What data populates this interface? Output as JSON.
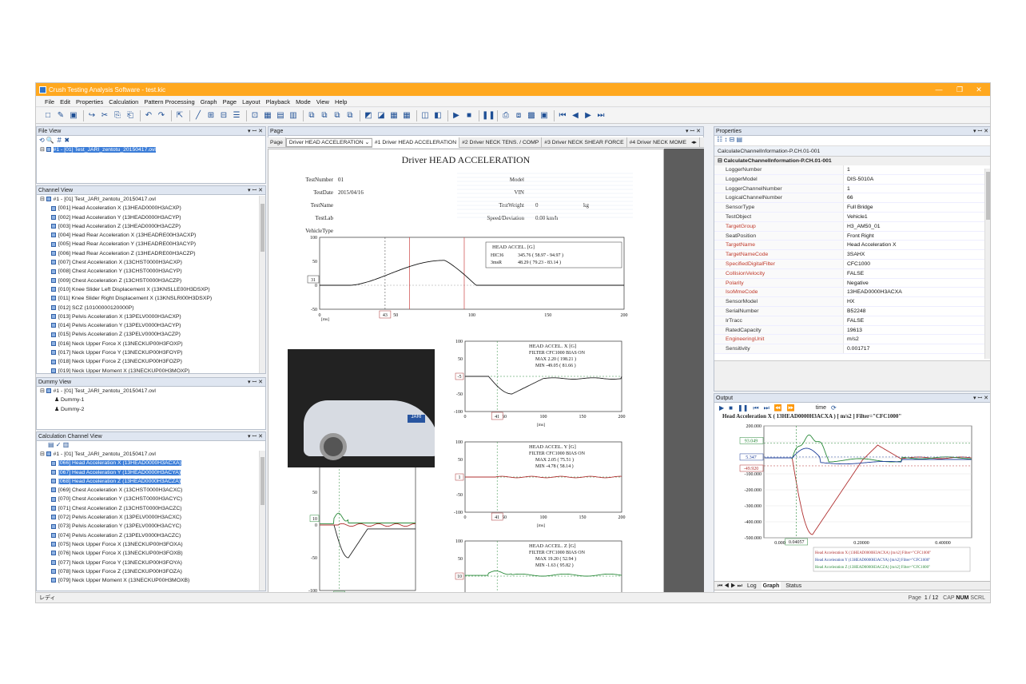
{
  "window": {
    "title": "Crush Testing Analysis Software - test.kic"
  },
  "menu": [
    "File",
    "Edit",
    "Properties",
    "Calculation",
    "Pattern Processing",
    "Graph",
    "Page",
    "Layout",
    "Playback",
    "Mode",
    "View",
    "Help"
  ],
  "file_view": {
    "title": "File View",
    "item": "#1 - [01] Test_JARI_zentotu_20150417.ovl"
  },
  "channel_view": {
    "title": "Channel View",
    "root": "#1 - [01] Test_JARI_zentotu_20150417.ovl",
    "items": [
      "[001] Head Acceleration X (13HEAD0000H3ACXP)",
      "[002] Head Acceleration Y (13HEAD0000H3ACYP)",
      "[003] Head Acceleration Z (13HEAD0000H3ACZP)",
      "[004] Head Rear Acceleration X (13HEADRE00H3ACXP)",
      "[005] Head Rear Acceleration Y (13HEADRE00H3ACYP)",
      "[006] Head Rear Acceleration Z (13HEADRE00H3ACZP)",
      "[007] Chest Acceleration X (13CHST0000H3ACXP)",
      "[008] Chest Acceleration Y (13CHST0000H3ACYP)",
      "[009] Chest Acceleration Z (13CHST0000H3ACZP)",
      "[010] Knee Slider Left Displacement X (13KNSLLE00H3DSXP)",
      "[011] Knee Slider Right Displacement X (13KNSLRI00H3DSXP)",
      "[012] SCZ (10100000120000P)",
      "[013] Pelvis Acceleration X (13PELV0000H3ACXP)",
      "[014] Pelvis Acceleration Y (13PELV0000H3ACYP)",
      "[015] Pelvis Acceleration Z (13PELV0000H3ACZP)",
      "[016] Neck Upper Force X (13NECKUP00H3FOXP)",
      "[017] Neck Upper Force Y (13NECKUP00H3FOYP)",
      "[018] Neck Upper Force Z (13NECKUP00H3FOZP)",
      "[019] Neck Upper Moment X (13NECKUP00H3MOXP)"
    ]
  },
  "dummy_view": {
    "title": "Dummy View",
    "root": "#1 - [01] Test_JARI_zentotu_20150417.ovl",
    "items": [
      "Dummy-1",
      "Dummy-2"
    ]
  },
  "calc_view": {
    "title": "Calculation Channel View",
    "root": "#1 - [01] Test_JARI_zentotu_20150417.ovl",
    "items": [
      "[066] Head Acceleration X (13HEAD0000H3ACXA)",
      "[067] Head Acceleration Y (13HEAD0000H3ACYA)",
      "[068] Head Acceleration Z (13HEAD0000H3ACZA)",
      "[069] Chest Acceleration X (13CHST0000H3ACXC)",
      "[070] Chest Acceleration Y (13CHST0000H3ACYC)",
      "[071] Chest Acceleration Z (13CHST0000H3ACZC)",
      "[072] Pelvis Acceleration X (13PELV0000H3ACXC)",
      "[073] Pelvis Acceleration Y (13PELV0000H3ACYC)",
      "[074] Pelvis Acceleration Z (13PELV0000H3ACZC)",
      "[075] Neck Upper Force X (13NECKUP00H3FOXA)",
      "[076] Neck Upper Force X (13NECKUP00H3FOXB)",
      "[077] Neck Upper Force Y (13NECKUP00H3FOYA)",
      "[078] Neck Upper Force Z (13NECKUP00H3FOZA)",
      "[079] Neck Upper Moment X (13NECKUP00H3MOXB)"
    ]
  },
  "page_panel": {
    "title": "Page",
    "label": "Page",
    "selected": "Driver HEAD ACCELERATION",
    "tabs": [
      "#1 Driver HEAD ACCELERATION",
      "#2 Driver NECK TENS. / COMP",
      "#3 Driver NECK SHEAR FORCE",
      "#4 Driver NECK MOME"
    ]
  },
  "report": {
    "title": "Driver HEAD ACCELERATION",
    "fields_left": [
      [
        "TestNumber",
        "01"
      ],
      [
        "TestDate",
        "2015/04/16"
      ],
      [
        "TestName",
        ""
      ],
      [
        "TestLab",
        ""
      ],
      [
        "VehicleType",
        ""
      ]
    ],
    "fields_right": [
      [
        "Model",
        ""
      ],
      [
        "VIN",
        ""
      ],
      [
        "TestWeight",
        "0",
        "kg"
      ],
      [
        "Speed/Deviation",
        "0.00 km/h",
        ""
      ]
    ]
  },
  "main_chart": {
    "box_title": "HEAD ACCEL. [G]",
    "hic_label": "HIC36",
    "hic": "345.76 (      58.97 -       94.97 )",
    "ms_label": "3msR",
    "ms": "48.29 (      79.23 -       83.14 )",
    "xlabel": "[ms]",
    "cursor_y": "31",
    "cursor_x": "43"
  },
  "small_x": {
    "title": "HEAD ACCEL. X [G]",
    "filter": "FILTER   CFC1000    BIAS   ON",
    "max": "MAX          2.20  (      198.21 )",
    "min": "MIN        -49.05  (        81.66 )",
    "cursor_y": "-5",
    "cursor_x": "41",
    "xlabel": "[ms]"
  },
  "small_y": {
    "title": "HEAD ACCEL. Y [G]",
    "filter": "FILTER   CFC1000    BIAS   ON",
    "max": "MAX          2.05  (       75.51 )",
    "min": "MIN         -4.78  (       58.14 )",
    "cursor_y": "1",
    "cursor_x": "41",
    "xlabel": "[ms]"
  },
  "small_z": {
    "title": "HEAD ACCEL. Z [G]",
    "filter": "FILTER   CFC1000    BIAS   ON",
    "max": "MAX         19.20  (       52.94 )",
    "min": "MIN         -1.63  (       95.82 )",
    "cursor_y": "10"
  },
  "overlay": {
    "title": "HEAD ACCEL. [G]",
    "cursor_y": "10",
    "cursor_x": "41"
  },
  "video": {
    "caption": "JARI"
  },
  "properties": {
    "title": "Properties",
    "tab": "CalculateChannelInformation-P.CH.01-001",
    "group": "CalculateChannelInformation-P.CH.01-001",
    "rows": [
      [
        "LoggerNumber",
        "1",
        false
      ],
      [
        "LoggerModel",
        "DIS-5010A",
        false
      ],
      [
        "LoggerChannelNumber",
        "1",
        false
      ],
      [
        "LogicalChannelNumber",
        "66",
        false
      ],
      [
        "SensorType",
        "Full Bridge",
        false
      ],
      [
        "TestObject",
        "Vehicle1",
        false
      ],
      [
        "TargetGroup",
        "H3_AM50_01",
        true
      ],
      [
        "SeatPosition",
        "Front Right",
        false
      ],
      [
        "TargetName",
        "Head Acceleration X",
        true
      ],
      [
        "TargetNameCode",
        "3SAHX",
        true
      ],
      [
        "SpecifiedDigitalFilter",
        "CFC1000",
        true
      ],
      [
        "CollisionVelocity",
        "FALSE",
        true
      ],
      [
        "Polarity",
        "Negative",
        true
      ],
      [
        "IsoMmeCode",
        "13HEAD0000H3ACXA",
        true
      ],
      [
        "SensorModel",
        "HX",
        false
      ],
      [
        "SerialNumber",
        "B52248",
        false
      ],
      [
        "IrTracc",
        "FALSE",
        false
      ],
      [
        "RatedCapacity",
        "19613",
        false
      ],
      [
        "EngineeringUnit",
        "m/s2",
        true
      ],
      [
        "Sensitivity",
        "0.001717",
        false
      ]
    ]
  },
  "output": {
    "title": "Output",
    "time_label": "time",
    "heading": "Head Acceleration X ( 13HEAD0000H3ACXA ) [ m/s2 ]    Filter=\"CFC1000\"",
    "yticks": [
      "200.000",
      "100.000",
      "0.000",
      "-100.000",
      "-200.000",
      "-300.000",
      "-400.000",
      "-500.000"
    ],
    "xticks": [
      "0.000",
      "0.20000",
      "0.40000"
    ],
    "xlabel": "Time [s]",
    "cursor_vals": [
      "93.049",
      "5.347",
      "-49.920"
    ],
    "cursor_x": "0.04057",
    "legend": [
      "Head Acceleration X (13HEAD0000H3ACXA) [m/s2]   Filter=\"CFC1000\"",
      "Head Acceleration Y (13HEAD0000H3ACYA) [m/s2]   Filter=\"CFC1000\"",
      "Head Acceleration Z (13HEAD0000H3ACZA) [m/s2]   Filter=\"CFC1000\""
    ],
    "tabs": [
      "Log",
      "Graph",
      "Status"
    ]
  },
  "status": {
    "left": "レディ",
    "page": "Page",
    "page_value": "1 / 12",
    "cap": "CAP",
    "num": "NUM",
    "scrl": "SCRL"
  },
  "colors": {
    "accent": "#ffa81f",
    "x": "#222222",
    "y": "#b03030",
    "z": "#2a8a3a"
  }
}
